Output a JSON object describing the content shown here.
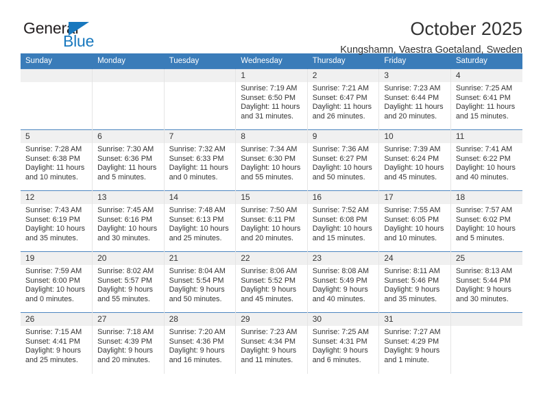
{
  "logo": {
    "word1": "General",
    "word2": "Blue",
    "accent_color": "#1878be",
    "text_color": "#231f20"
  },
  "header": {
    "title": "October 2025",
    "subtitle": "Kungshamn, Vaestra Goetaland, Sweden",
    "header_bg": "#3a7cb9"
  },
  "weekday_headers": [
    "Sunday",
    "Monday",
    "Tuesday",
    "Wednesday",
    "Thursday",
    "Friday",
    "Saturday"
  ],
  "weeks": [
    [
      {
        "day": "",
        "empty": true
      },
      {
        "day": "",
        "empty": true
      },
      {
        "day": "",
        "empty": true
      },
      {
        "day": "1",
        "sunrise": "Sunrise: 7:19 AM",
        "sunset": "Sunset: 6:50 PM",
        "daylight1": "Daylight: 11 hours",
        "daylight2": "and 31 minutes."
      },
      {
        "day": "2",
        "sunrise": "Sunrise: 7:21 AM",
        "sunset": "Sunset: 6:47 PM",
        "daylight1": "Daylight: 11 hours",
        "daylight2": "and 26 minutes."
      },
      {
        "day": "3",
        "sunrise": "Sunrise: 7:23 AM",
        "sunset": "Sunset: 6:44 PM",
        "daylight1": "Daylight: 11 hours",
        "daylight2": "and 20 minutes."
      },
      {
        "day": "4",
        "sunrise": "Sunrise: 7:25 AM",
        "sunset": "Sunset: 6:41 PM",
        "daylight1": "Daylight: 11 hours",
        "daylight2": "and 15 minutes."
      }
    ],
    [
      {
        "day": "5",
        "sunrise": "Sunrise: 7:28 AM",
        "sunset": "Sunset: 6:38 PM",
        "daylight1": "Daylight: 11 hours",
        "daylight2": "and 10 minutes."
      },
      {
        "day": "6",
        "sunrise": "Sunrise: 7:30 AM",
        "sunset": "Sunset: 6:36 PM",
        "daylight1": "Daylight: 11 hours",
        "daylight2": "and 5 minutes."
      },
      {
        "day": "7",
        "sunrise": "Sunrise: 7:32 AM",
        "sunset": "Sunset: 6:33 PM",
        "daylight1": "Daylight: 11 hours",
        "daylight2": "and 0 minutes."
      },
      {
        "day": "8",
        "sunrise": "Sunrise: 7:34 AM",
        "sunset": "Sunset: 6:30 PM",
        "daylight1": "Daylight: 10 hours",
        "daylight2": "and 55 minutes."
      },
      {
        "day": "9",
        "sunrise": "Sunrise: 7:36 AM",
        "sunset": "Sunset: 6:27 PM",
        "daylight1": "Daylight: 10 hours",
        "daylight2": "and 50 minutes."
      },
      {
        "day": "10",
        "sunrise": "Sunrise: 7:39 AM",
        "sunset": "Sunset: 6:24 PM",
        "daylight1": "Daylight: 10 hours",
        "daylight2": "and 45 minutes."
      },
      {
        "day": "11",
        "sunrise": "Sunrise: 7:41 AM",
        "sunset": "Sunset: 6:22 PM",
        "daylight1": "Daylight: 10 hours",
        "daylight2": "and 40 minutes."
      }
    ],
    [
      {
        "day": "12",
        "sunrise": "Sunrise: 7:43 AM",
        "sunset": "Sunset: 6:19 PM",
        "daylight1": "Daylight: 10 hours",
        "daylight2": "and 35 minutes."
      },
      {
        "day": "13",
        "sunrise": "Sunrise: 7:45 AM",
        "sunset": "Sunset: 6:16 PM",
        "daylight1": "Daylight: 10 hours",
        "daylight2": "and 30 minutes."
      },
      {
        "day": "14",
        "sunrise": "Sunrise: 7:48 AM",
        "sunset": "Sunset: 6:13 PM",
        "daylight1": "Daylight: 10 hours",
        "daylight2": "and 25 minutes."
      },
      {
        "day": "15",
        "sunrise": "Sunrise: 7:50 AM",
        "sunset": "Sunset: 6:11 PM",
        "daylight1": "Daylight: 10 hours",
        "daylight2": "and 20 minutes."
      },
      {
        "day": "16",
        "sunrise": "Sunrise: 7:52 AM",
        "sunset": "Sunset: 6:08 PM",
        "daylight1": "Daylight: 10 hours",
        "daylight2": "and 15 minutes."
      },
      {
        "day": "17",
        "sunrise": "Sunrise: 7:55 AM",
        "sunset": "Sunset: 6:05 PM",
        "daylight1": "Daylight: 10 hours",
        "daylight2": "and 10 minutes."
      },
      {
        "day": "18",
        "sunrise": "Sunrise: 7:57 AM",
        "sunset": "Sunset: 6:02 PM",
        "daylight1": "Daylight: 10 hours",
        "daylight2": "and 5 minutes."
      }
    ],
    [
      {
        "day": "19",
        "sunrise": "Sunrise: 7:59 AM",
        "sunset": "Sunset: 6:00 PM",
        "daylight1": "Daylight: 10 hours",
        "daylight2": "and 0 minutes."
      },
      {
        "day": "20",
        "sunrise": "Sunrise: 8:02 AM",
        "sunset": "Sunset: 5:57 PM",
        "daylight1": "Daylight: 9 hours",
        "daylight2": "and 55 minutes."
      },
      {
        "day": "21",
        "sunrise": "Sunrise: 8:04 AM",
        "sunset": "Sunset: 5:54 PM",
        "daylight1": "Daylight: 9 hours",
        "daylight2": "and 50 minutes."
      },
      {
        "day": "22",
        "sunrise": "Sunrise: 8:06 AM",
        "sunset": "Sunset: 5:52 PM",
        "daylight1": "Daylight: 9 hours",
        "daylight2": "and 45 minutes."
      },
      {
        "day": "23",
        "sunrise": "Sunrise: 8:08 AM",
        "sunset": "Sunset: 5:49 PM",
        "daylight1": "Daylight: 9 hours",
        "daylight2": "and 40 minutes."
      },
      {
        "day": "24",
        "sunrise": "Sunrise: 8:11 AM",
        "sunset": "Sunset: 5:46 PM",
        "daylight1": "Daylight: 9 hours",
        "daylight2": "and 35 minutes."
      },
      {
        "day": "25",
        "sunrise": "Sunrise: 8:13 AM",
        "sunset": "Sunset: 5:44 PM",
        "daylight1": "Daylight: 9 hours",
        "daylight2": "and 30 minutes."
      }
    ],
    [
      {
        "day": "26",
        "sunrise": "Sunrise: 7:15 AM",
        "sunset": "Sunset: 4:41 PM",
        "daylight1": "Daylight: 9 hours",
        "daylight2": "and 25 minutes."
      },
      {
        "day": "27",
        "sunrise": "Sunrise: 7:18 AM",
        "sunset": "Sunset: 4:39 PM",
        "daylight1": "Daylight: 9 hours",
        "daylight2": "and 20 minutes."
      },
      {
        "day": "28",
        "sunrise": "Sunrise: 7:20 AM",
        "sunset": "Sunset: 4:36 PM",
        "daylight1": "Daylight: 9 hours",
        "daylight2": "and 16 minutes."
      },
      {
        "day": "29",
        "sunrise": "Sunrise: 7:23 AM",
        "sunset": "Sunset: 4:34 PM",
        "daylight1": "Daylight: 9 hours",
        "daylight2": "and 11 minutes."
      },
      {
        "day": "30",
        "sunrise": "Sunrise: 7:25 AM",
        "sunset": "Sunset: 4:31 PM",
        "daylight1": "Daylight: 9 hours",
        "daylight2": "and 6 minutes."
      },
      {
        "day": "31",
        "sunrise": "Sunrise: 7:27 AM",
        "sunset": "Sunset: 4:29 PM",
        "daylight1": "Daylight: 9 hours",
        "daylight2": "and 1 minute."
      },
      {
        "day": "",
        "empty": true
      }
    ]
  ]
}
